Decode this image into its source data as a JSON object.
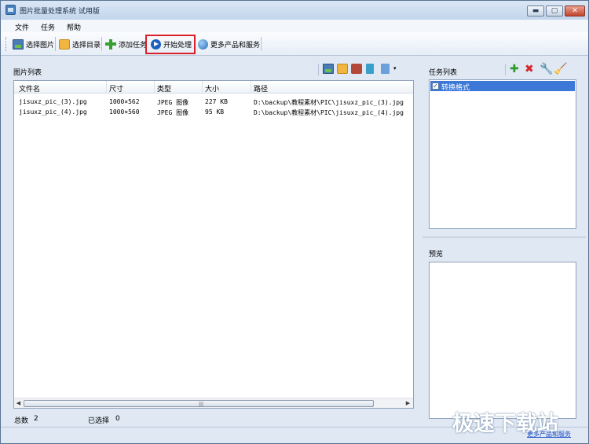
{
  "window": {
    "title": "图片批量处理系统 试用版",
    "controls": {
      "minimize": "▬",
      "maximize": "▢",
      "close": "✕"
    }
  },
  "menu": [
    "文件",
    "任务",
    "帮助"
  ],
  "toolbar": {
    "select_image": "选择图片",
    "select_folder": "选择目录",
    "add_task": "添加任务",
    "start_process": "开始处理",
    "more_products": "更多产品和服务"
  },
  "image_list": {
    "label": "图片列表",
    "columns": [
      "文件名",
      "尺寸",
      "类型",
      "大小",
      "路径"
    ],
    "rows": [
      {
        "name": "jisuxz_pic_(3).jpg",
        "size": "1000×562",
        "type": "JPEG 图像",
        "filesize": "227 KB",
        "path": "D:\\backup\\教程素材\\PIC\\jisuxz_pic_(3).jpg"
      },
      {
        "name": "jisuxz_pic_(4).jpg",
        "size": "1000×560",
        "type": "JPEG 图像",
        "filesize": "95 KB",
        "path": "D:\\backup\\教程素材\\PIC\\jisuxz_pic_(4).jpg"
      }
    ]
  },
  "status": {
    "total_label": "总数",
    "total_value": "2",
    "selected_label": "已选择",
    "selected_value": "0"
  },
  "task_list": {
    "label": "任务列表",
    "items": [
      {
        "label": "转换格式",
        "checked": true
      }
    ]
  },
  "preview": {
    "label": "预览"
  },
  "watermark": "极速下载站",
  "footer_link": "更多产品和服务",
  "colors": {
    "highlight": "#d8202a",
    "selection": "#3b78d8"
  }
}
